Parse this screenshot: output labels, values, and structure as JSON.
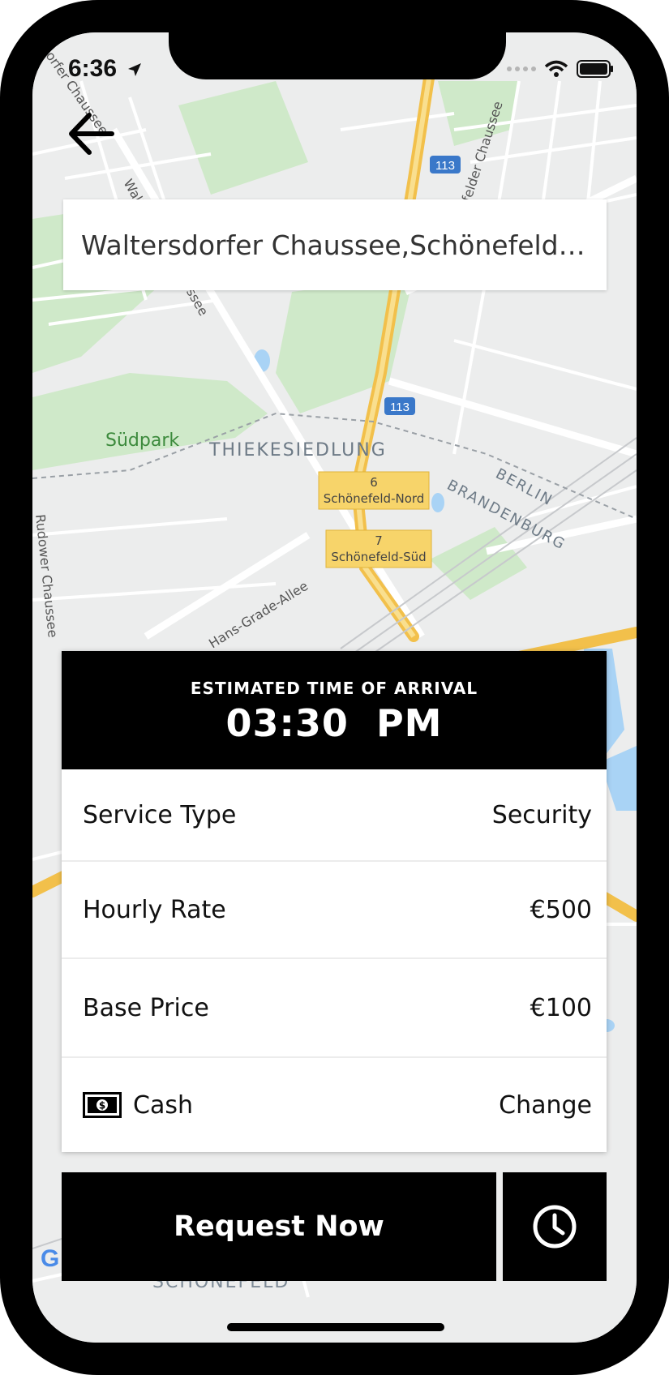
{
  "status_bar": {
    "time": "6:36"
  },
  "search": {
    "address": "Waltersdorfer Chaussee,Schönefeld,Da..."
  },
  "map": {
    "labels": {
      "suedpark": "Südpark",
      "thiekesiedlung": "THIEKESIEDLUNG",
      "berlin": "BERLIN",
      "brandenburg": "BRANDENBURG",
      "schoenefeld": "SCHÖNEFELD",
      "road_rudower": "Rudower Chaussee",
      "road_waltersdorfer": "Waltersdorfer Chaussee",
      "road_grade_allee": "Hans-Grade-Allee",
      "road_top_left": "dorfer Chaussee",
      "road_top_right": "felder Chaussee"
    },
    "route_shields": [
      "113",
      "113"
    ],
    "exits": [
      {
        "number": "6",
        "name": "Schönefeld-Nord"
      },
      {
        "number": "7",
        "name": "Schönefeld-Süd"
      }
    ],
    "google_logo": "G"
  },
  "eta": {
    "title": "ESTIMATED TIME OF ARRIVAL",
    "time": "03:30  PM"
  },
  "details": [
    {
      "label": "Service Type",
      "value": "Security"
    },
    {
      "label": "Hourly Rate",
      "value": "€500"
    },
    {
      "label": "Base Price",
      "value": "€100"
    }
  ],
  "payment": {
    "method": "Cash",
    "action": "Change",
    "icon": "cash-icon"
  },
  "actions": {
    "request_label": "Request Now",
    "schedule_icon": "clock-icon"
  },
  "colors": {
    "primary": "#000000",
    "map_bg": "#eceded",
    "highway": "#f5c542",
    "park": "#cfe9c9",
    "water": "#a9d3f5"
  }
}
